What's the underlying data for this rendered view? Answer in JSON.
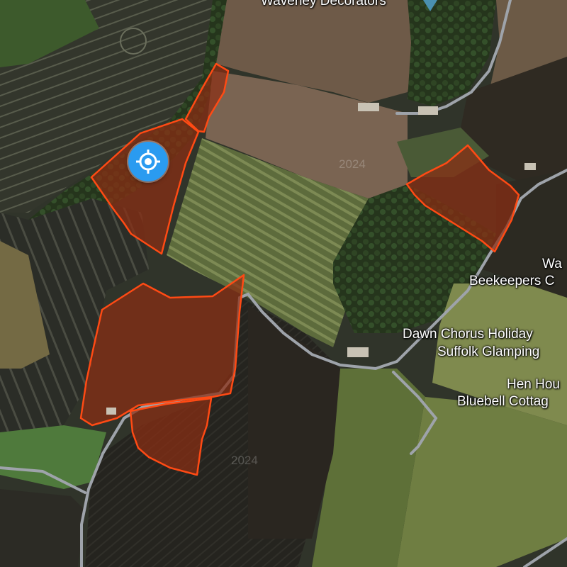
{
  "map": {
    "type": "satellite",
    "field_highlight_fill": "#8a2e14",
    "field_highlight_stroke": "#ff4a14",
    "road_color": "#b8bcc4",
    "location_button_color": "#2a9bf0",
    "locate_icon": "crosshair-icon"
  },
  "labels": {
    "top_business": "Waveney Decorators",
    "watermark_1": "2024",
    "watermark_2": "2024",
    "beekeepers_line1": "Wa",
    "beekeepers_line2": "Beekeepers C",
    "dawn_line1": "Dawn Chorus Holiday",
    "dawn_line2": "Suffolk Glamping",
    "hen_line1": "Hen Hou",
    "hen_line2": "Bluebell Cottag"
  }
}
